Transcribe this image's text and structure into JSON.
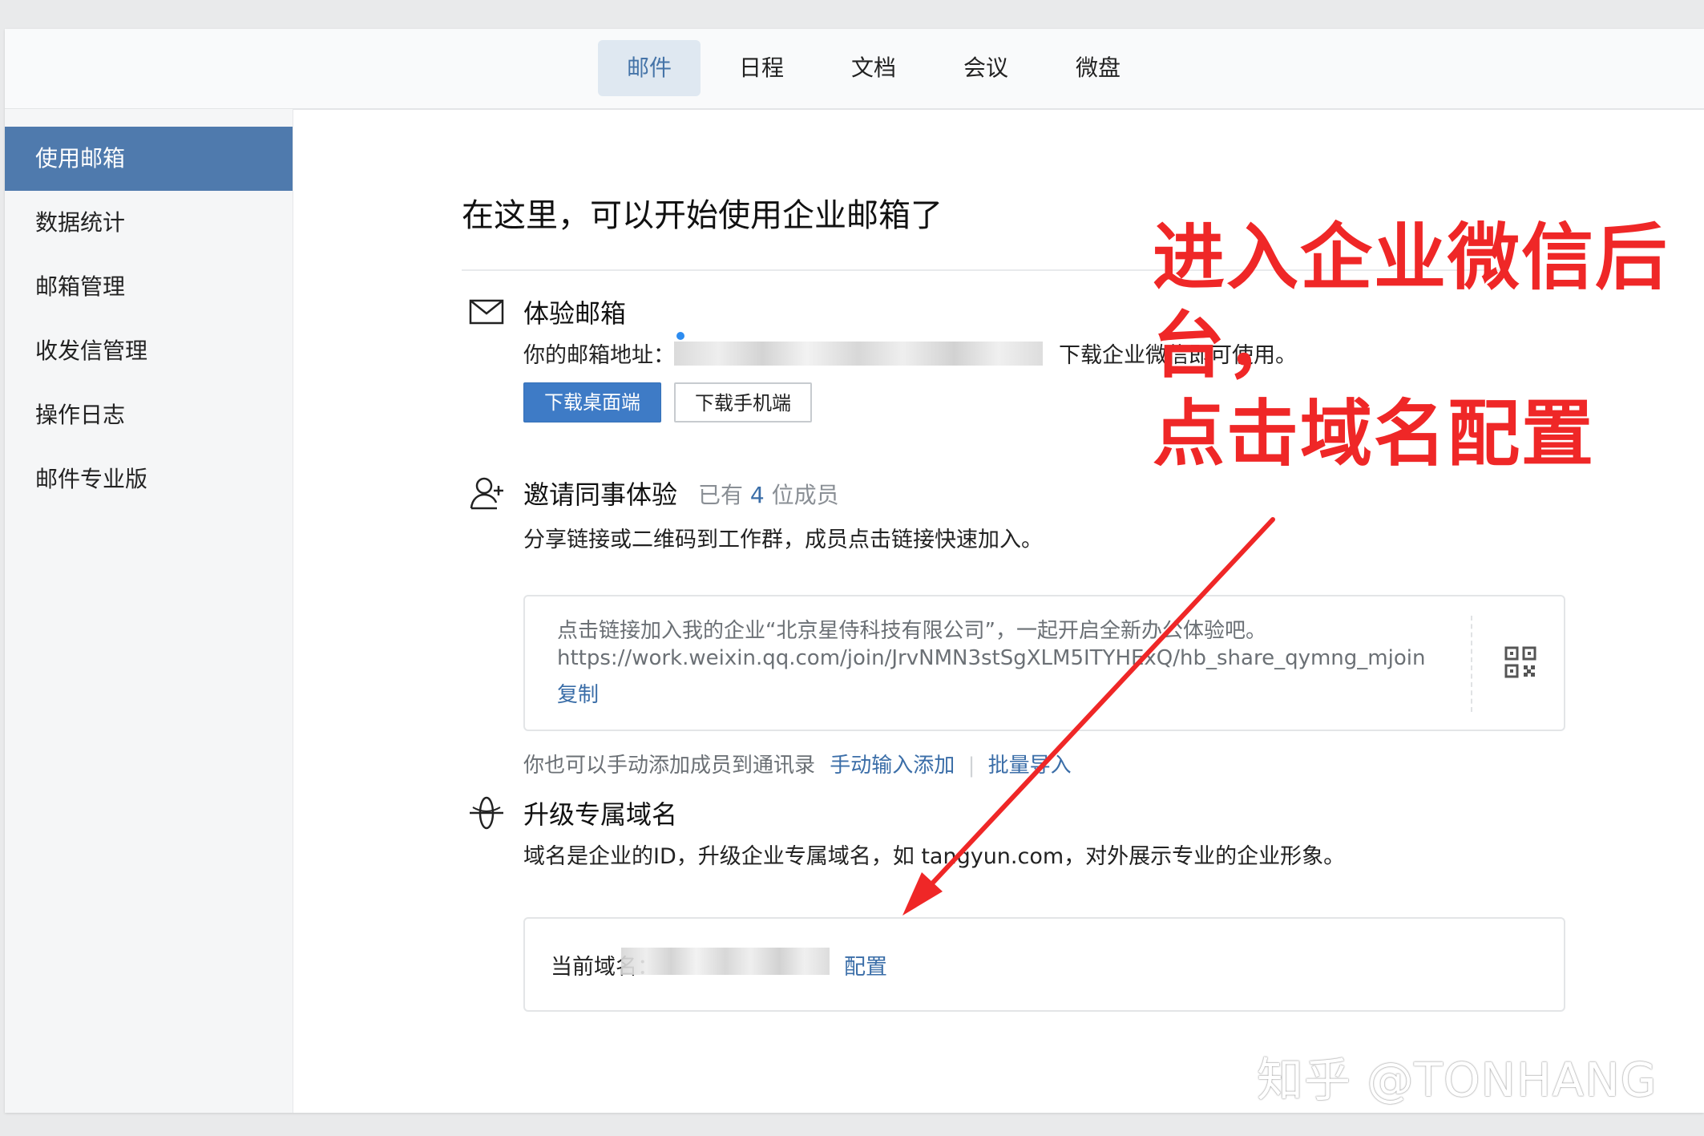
{
  "nav": {
    "tabs": [
      {
        "label": "邮件",
        "active": true
      },
      {
        "label": "日程",
        "active": false
      },
      {
        "label": "文档",
        "active": false
      },
      {
        "label": "会议",
        "active": false
      },
      {
        "label": "微盘",
        "active": false
      }
    ]
  },
  "sidebar": {
    "items": [
      {
        "label": "使用邮箱",
        "active": true
      },
      {
        "label": "数据统计",
        "active": false
      },
      {
        "label": "邮箱管理",
        "active": false
      },
      {
        "label": "收发信管理",
        "active": false
      },
      {
        "label": "操作日志",
        "active": false
      },
      {
        "label": "邮件专业版",
        "active": false
      }
    ]
  },
  "main": {
    "title": "在这里，可以开始使用企业邮箱了",
    "experience": {
      "icon": "mail-icon",
      "title": "体验邮箱",
      "address_prefix": "你的邮箱地址：",
      "address_suffix": "下载企业微信即可使用。",
      "download_desktop": "下载桌面端",
      "download_mobile": "下载手机端"
    },
    "invite": {
      "icon": "add-user-icon",
      "title": "邀请同事体验",
      "member_prefix": "已有",
      "member_count": "4",
      "member_suffix": "位成员",
      "description": "分享链接或二维码到工作群，成员点击链接快速加入。",
      "share_text": "点击链接加入我的企业“北京星侍科技有限公司”，一起开启全新办公体验吧。",
      "share_url": "https://work.weixin.qq.com/join/JrvNMN3stSgXLM5ITYHExQ/hb_share_qymng_mjoin",
      "copy_label": "复制",
      "qr_icon": "qr-code-icon",
      "manual_text": "你也可以手动添加成员到通讯录",
      "manual_link": "手动输入添加",
      "batch_link": "批量导入"
    },
    "domain": {
      "icon": "globe-icon",
      "title": "升级专属域名",
      "description": "域名是企业的ID，升级企业专属域名，如 tangyun.com，对外展示专业的企业形象。",
      "current_label": "当前域名：",
      "configure_link": "配置"
    }
  },
  "annotation": {
    "line1": "进入企业微信后",
    "line2": "台，",
    "line3": "点击域名配置",
    "color": "#ef2727"
  },
  "watermark": "知乎 @TONHANG"
}
